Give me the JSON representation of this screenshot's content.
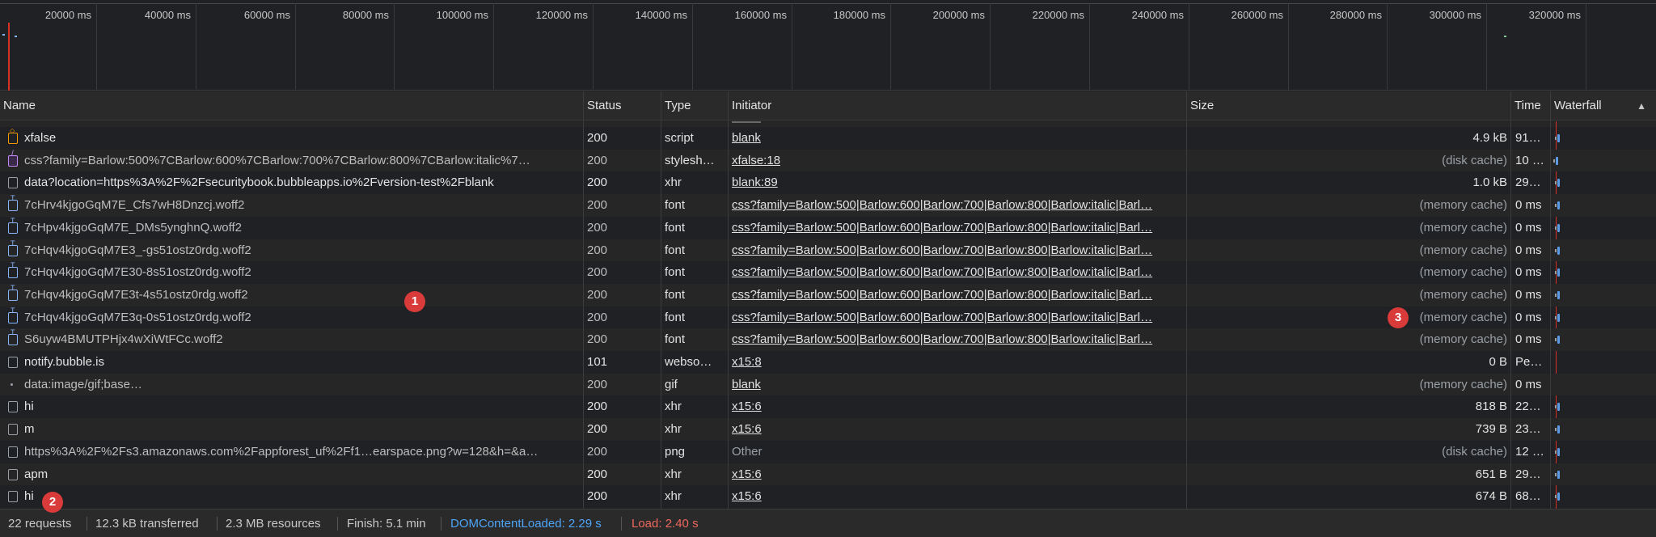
{
  "overview": {
    "ticks": [
      "20000 ms",
      "40000 ms",
      "60000 ms",
      "80000 ms",
      "100000 ms",
      "120000 ms",
      "140000 ms",
      "160000 ms",
      "180000 ms",
      "200000 ms",
      "220000 ms",
      "240000 ms",
      "260000 ms",
      "280000 ms",
      "300000 ms",
      "320000 ms"
    ]
  },
  "columns": {
    "name": "Name",
    "status": "Status",
    "type": "Type",
    "initiator": "Initiator",
    "size": "Size",
    "time": "Time",
    "waterfall": "Waterfall",
    "sort_arrow": "▲"
  },
  "colors": {
    "accent_blue": "#4ea4f6",
    "load_red": "#ee675c",
    "badge_red": "#d93b3b"
  },
  "rows": [
    {
      "icon": "script-icon",
      "name": "xfalse",
      "status": "200",
      "type": "script",
      "initiator": "blank",
      "size": "4.9 kB",
      "time": "91…"
    },
    {
      "icon": "stylesheet-icon",
      "name": "css?family=Barlow:500%7CBarlow:600%7CBarlow:700%7CBarlow:800%7CBarlow:italic%7…",
      "status": "200",
      "type": "stylesh…",
      "initiator": "xfalse:18",
      "size": "(disk cache)",
      "time": "10 …"
    },
    {
      "icon": "document-icon",
      "name": "data?location=https%3A%2F%2Fsecuritybook.bubbleapps.io%2Fversion-test%2Fblank",
      "status": "200",
      "type": "xhr",
      "initiator": "blank:89",
      "size": "1.0 kB",
      "time": "29…"
    },
    {
      "icon": "font-icon",
      "name": "7cHrv4kjgoGqM7E_Cfs7wH8Dnzcj.woff2",
      "status": "200",
      "type": "font",
      "initiator": "css?family=Barlow:500|Barlow:600|Barlow:700|Barlow:800|Barlow:italic|Barl…",
      "size": "(memory cache)",
      "time": "0 ms"
    },
    {
      "icon": "font-icon",
      "name": "7cHpv4kjgoGqM7E_DMs5ynghnQ.woff2",
      "status": "200",
      "type": "font",
      "initiator": "css?family=Barlow:500|Barlow:600|Barlow:700|Barlow:800|Barlow:italic|Barl…",
      "size": "(memory cache)",
      "time": "0 ms"
    },
    {
      "icon": "font-icon",
      "name": "7cHqv4kjgoGqM7E3_-gs51ostz0rdg.woff2",
      "status": "200",
      "type": "font",
      "initiator": "css?family=Barlow:500|Barlow:600|Barlow:700|Barlow:800|Barlow:italic|Barl…",
      "size": "(memory cache)",
      "time": "0 ms"
    },
    {
      "icon": "font-icon",
      "name": "7cHqv4kjgoGqM7E30-8s51ostz0rdg.woff2",
      "status": "200",
      "type": "font",
      "initiator": "css?family=Barlow:500|Barlow:600|Barlow:700|Barlow:800|Barlow:italic|Barl…",
      "size": "(memory cache)",
      "time": "0 ms"
    },
    {
      "icon": "font-icon",
      "name": "7cHqv4kjgoGqM7E3t-4s51ostz0rdg.woff2",
      "status": "200",
      "type": "font",
      "initiator": "css?family=Barlow:500|Barlow:600|Barlow:700|Barlow:800|Barlow:italic|Barl…",
      "size": "(memory cache)",
      "time": "0 ms"
    },
    {
      "icon": "font-icon",
      "name": "7cHqv4kjgoGqM7E3q-0s51ostz0rdg.woff2",
      "status": "200",
      "type": "font",
      "initiator": "css?family=Barlow:500|Barlow:600|Barlow:700|Barlow:800|Barlow:italic|Barl…",
      "size": "(memory cache)",
      "time": "0 ms"
    },
    {
      "icon": "font-icon",
      "name": "S6uyw4BMUTPHjx4wXiWtFCc.woff2",
      "status": "200",
      "type": "font",
      "initiator": "css?family=Barlow:500|Barlow:600|Barlow:700|Barlow:800|Barlow:italic|Barl…",
      "size": "(memory cache)",
      "time": "0 ms"
    },
    {
      "icon": "document-icon",
      "name": "notify.bubble.is",
      "status": "101",
      "type": "webso…",
      "initiator": "x15:8",
      "size": "0 B",
      "time": "Pe…"
    },
    {
      "icon": "dot-icon",
      "name": "data:image/gif;base…",
      "status": "200",
      "type": "gif",
      "initiator": "blank",
      "size": "(memory cache)",
      "time": "0 ms"
    },
    {
      "icon": "document-icon",
      "name": "hi",
      "status": "200",
      "type": "xhr",
      "initiator": "x15:6",
      "size": "818 B",
      "time": "22…"
    },
    {
      "icon": "document-icon",
      "name": "m",
      "status": "200",
      "type": "xhr",
      "initiator": "x15:6",
      "size": "739 B",
      "time": "23…"
    },
    {
      "icon": "document-icon",
      "name": "https%3A%2F%2Fs3.amazonaws.com%2Fappforest_uf%2Ff1…earspace.png?w=128&h=&a…",
      "status": "200",
      "type": "png",
      "initiator": "Other",
      "size": "(disk cache)",
      "time": "12 …"
    },
    {
      "icon": "document-icon",
      "name": "apm",
      "status": "200",
      "type": "xhr",
      "initiator": "x15:6",
      "size": "651 B",
      "time": "29…"
    },
    {
      "icon": "document-icon",
      "name": "hi",
      "status": "200",
      "type": "xhr",
      "initiator": "x15:6",
      "size": "674 B",
      "time": "68…"
    }
  ],
  "statusbar": {
    "requests": "22 requests",
    "transferred": "12.3 kB transferred",
    "resources": "2.3 MB resources",
    "finish": "Finish: 5.1 min",
    "dcl": "DOMContentLoaded: 2.29 s",
    "load": "Load: 2.40 s"
  },
  "badges": [
    "1",
    "2",
    "3"
  ]
}
